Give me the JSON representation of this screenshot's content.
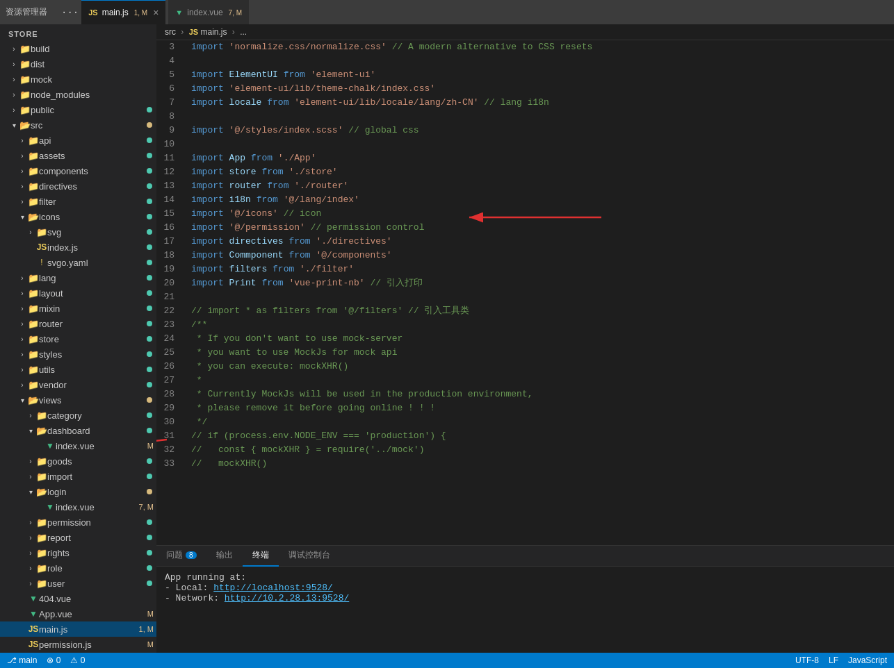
{
  "titleBar": {
    "title": "资源管理器",
    "dotsLabel": "···"
  },
  "tabs": [
    {
      "id": "main-js",
      "icon": "JS",
      "iconType": "js",
      "label": "main.js",
      "badge": "1, M",
      "active": true,
      "closable": true
    },
    {
      "id": "index-vue",
      "icon": "▼",
      "iconType": "vue",
      "label": "index.vue",
      "badge": "7, M",
      "active": false,
      "closable": false
    }
  ],
  "breadcrumb": {
    "parts": [
      "src",
      "JS main.js",
      "..."
    ]
  },
  "sidebar": {
    "header": "STORE",
    "items": [
      {
        "id": "build",
        "label": "build",
        "type": "folder",
        "indent": 1,
        "expanded": false,
        "badge": null
      },
      {
        "id": "dist",
        "label": "dist",
        "type": "folder",
        "indent": 1,
        "expanded": false,
        "badge": null
      },
      {
        "id": "mock",
        "label": "mock",
        "type": "folder",
        "indent": 1,
        "expanded": false,
        "badge": null
      },
      {
        "id": "node_modules",
        "label": "node_modules",
        "type": "folder",
        "indent": 1,
        "expanded": false,
        "badge": null
      },
      {
        "id": "public",
        "label": "public",
        "type": "folder",
        "indent": 1,
        "expanded": false,
        "badge": "green"
      },
      {
        "id": "src",
        "label": "src",
        "type": "folder",
        "indent": 1,
        "expanded": true,
        "badge": "orange"
      },
      {
        "id": "api",
        "label": "api",
        "type": "folder",
        "indent": 2,
        "expanded": false,
        "badge": "green"
      },
      {
        "id": "assets",
        "label": "assets",
        "type": "folder",
        "indent": 2,
        "expanded": false,
        "badge": "green"
      },
      {
        "id": "components",
        "label": "components",
        "type": "folder",
        "indent": 2,
        "expanded": false,
        "badge": "green"
      },
      {
        "id": "directives",
        "label": "directives",
        "type": "folder",
        "indent": 2,
        "expanded": false,
        "badge": "green"
      },
      {
        "id": "filter",
        "label": "filter",
        "type": "folder",
        "indent": 2,
        "expanded": false,
        "badge": "green"
      },
      {
        "id": "icons",
        "label": "icons",
        "type": "folder",
        "indent": 2,
        "expanded": true,
        "badge": "green"
      },
      {
        "id": "svg",
        "label": "svg",
        "type": "folder",
        "indent": 3,
        "expanded": false,
        "badge": "green"
      },
      {
        "id": "index-js",
        "label": "index.js",
        "type": "js",
        "indent": 3,
        "expanded": false,
        "badge": "green"
      },
      {
        "id": "svgo-yaml",
        "label": "svgo.yaml",
        "type": "yaml",
        "indent": 3,
        "expanded": false,
        "badge": "green"
      },
      {
        "id": "lang",
        "label": "lang",
        "type": "folder",
        "indent": 2,
        "expanded": false,
        "badge": "green"
      },
      {
        "id": "layout",
        "label": "layout",
        "type": "folder",
        "indent": 2,
        "expanded": false,
        "badge": "green"
      },
      {
        "id": "mixin",
        "label": "mixin",
        "type": "folder",
        "indent": 2,
        "expanded": false,
        "badge": "green"
      },
      {
        "id": "router",
        "label": "router",
        "type": "folder",
        "indent": 2,
        "expanded": false,
        "badge": "green"
      },
      {
        "id": "store",
        "label": "store",
        "type": "folder",
        "indent": 2,
        "expanded": false,
        "badge": "green"
      },
      {
        "id": "styles",
        "label": "styles",
        "type": "folder",
        "indent": 2,
        "expanded": false,
        "badge": "green"
      },
      {
        "id": "utils",
        "label": "utils",
        "type": "folder",
        "indent": 2,
        "expanded": false,
        "badge": "green"
      },
      {
        "id": "vendor",
        "label": "vendor",
        "type": "folder",
        "indent": 2,
        "expanded": false,
        "badge": "green"
      },
      {
        "id": "views",
        "label": "views",
        "type": "folder",
        "indent": 2,
        "expanded": true,
        "badge": "orange"
      },
      {
        "id": "category",
        "label": "category",
        "type": "folder",
        "indent": 3,
        "expanded": false,
        "badge": "green"
      },
      {
        "id": "dashboard",
        "label": "dashboard",
        "type": "folder",
        "indent": 3,
        "expanded": true,
        "badge": "green"
      },
      {
        "id": "dashboard-index",
        "label": "index.vue",
        "type": "vue",
        "indent": 4,
        "badge": "M"
      },
      {
        "id": "goods",
        "label": "goods",
        "type": "folder",
        "indent": 3,
        "expanded": false,
        "badge": "green"
      },
      {
        "id": "import",
        "label": "import",
        "type": "folder",
        "indent": 3,
        "expanded": false,
        "badge": "green"
      },
      {
        "id": "login",
        "label": "login",
        "type": "folder",
        "indent": 3,
        "expanded": true,
        "badge": "orange"
      },
      {
        "id": "login-index",
        "label": "index.vue",
        "type": "vue",
        "indent": 4,
        "badge": "7, M"
      },
      {
        "id": "permission",
        "label": "permission",
        "type": "folder",
        "indent": 3,
        "expanded": false,
        "badge": "green"
      },
      {
        "id": "report",
        "label": "report",
        "type": "folder",
        "indent": 3,
        "expanded": false,
        "badge": "green"
      },
      {
        "id": "rights",
        "label": "rights",
        "type": "folder",
        "indent": 3,
        "expanded": false,
        "badge": "green"
      },
      {
        "id": "role",
        "label": "role",
        "type": "folder",
        "indent": 3,
        "expanded": false,
        "badge": "green"
      },
      {
        "id": "user",
        "label": "user",
        "type": "folder",
        "indent": 3,
        "expanded": false,
        "badge": "green"
      },
      {
        "id": "404-vue",
        "label": "404.vue",
        "type": "vue",
        "indent": 2,
        "badge": null
      },
      {
        "id": "app-vue",
        "label": "App.vue",
        "type": "vue",
        "indent": 2,
        "badge": "M"
      },
      {
        "id": "main-js-side",
        "label": "main.js",
        "type": "js",
        "indent": 2,
        "badge": "1, M",
        "selected": true
      },
      {
        "id": "permission-js",
        "label": "permission.js",
        "type": "js",
        "indent": 2,
        "badge": "M"
      }
    ]
  },
  "codeLines": [
    {
      "num": 3,
      "indicator": false,
      "content": "import·'normalize.css/normalize.css'·//·A·modern·alternative·to·CSS·resets",
      "tokens": [
        {
          "t": "kw",
          "v": "import"
        },
        {
          "t": "str",
          "v": "'normalize.css/normalize.css'"
        },
        {
          "t": "cmt",
          "v": "//·A·modern·alternative·to·CSS·resets"
        }
      ]
    },
    {
      "num": 4,
      "indicator": false,
      "content": "",
      "tokens": []
    },
    {
      "num": 5,
      "indicator": false,
      "content": "import·ElementUI·from·'element-ui'",
      "tokens": [
        {
          "t": "kw",
          "v": "import"
        },
        {
          "t": "var",
          "v": "ElementUI"
        },
        {
          "t": "kw",
          "v": "from"
        },
        {
          "t": "str",
          "v": "'element-ui'"
        }
      ]
    },
    {
      "num": 6,
      "indicator": false,
      "content": "import·'element-ui/lib/theme-chalk/index.css'",
      "tokens": [
        {
          "t": "kw",
          "v": "import"
        },
        {
          "t": "str",
          "v": "'element-ui/lib/theme-chalk/index.css'"
        }
      ]
    },
    {
      "num": 7,
      "indicator": true,
      "content": "import·locale·from·'element-ui/lib/locale/lang/zh-CN'·//·lang·i18n",
      "tokens": [
        {
          "t": "kw",
          "v": "import"
        },
        {
          "t": "var",
          "v": "locale"
        },
        {
          "t": "kw",
          "v": "from"
        },
        {
          "t": "str",
          "v": "'element-ui/lib/locale/lang/zh-CN'"
        },
        {
          "t": "cmt",
          "v": "//·lang·i18n"
        }
      ]
    },
    {
      "num": 8,
      "indicator": false,
      "content": "",
      "tokens": []
    },
    {
      "num": 9,
      "indicator": false,
      "content": "import·'@/styles/index.scss'·//·global·css",
      "tokens": [
        {
          "t": "kw",
          "v": "import"
        },
        {
          "t": "str",
          "v": "'@/styles/index.scss'"
        },
        {
          "t": "cmt",
          "v": "//·global·css"
        }
      ]
    },
    {
      "num": 10,
      "indicator": false,
      "content": "",
      "tokens": []
    },
    {
      "num": 11,
      "indicator": false,
      "content": "import·App·from·'./App'",
      "tokens": [
        {
          "t": "kw",
          "v": "import"
        },
        {
          "t": "var",
          "v": "App"
        },
        {
          "t": "kw",
          "v": "from"
        },
        {
          "t": "str",
          "v": "'./App'"
        }
      ]
    },
    {
      "num": 12,
      "indicator": false,
      "content": "import·store·from·'./store'",
      "tokens": [
        {
          "t": "kw",
          "v": "import"
        },
        {
          "t": "var",
          "v": "store"
        },
        {
          "t": "kw",
          "v": "from"
        },
        {
          "t": "str",
          "v": "'./store'"
        }
      ]
    },
    {
      "num": 13,
      "indicator": false,
      "content": "import·router·from·'./router'",
      "tokens": [
        {
          "t": "kw",
          "v": "import"
        },
        {
          "t": "var",
          "v": "router"
        },
        {
          "t": "kw",
          "v": "from"
        },
        {
          "t": "str",
          "v": "'./router'"
        }
      ]
    },
    {
      "num": 14,
      "indicator": false,
      "content": "import·i18n·from·'@/lang/index'",
      "tokens": [
        {
          "t": "kw",
          "v": "import"
        },
        {
          "t": "var",
          "v": "i18n"
        },
        {
          "t": "kw",
          "v": "from"
        },
        {
          "t": "str",
          "v": "'@/lang/index'"
        }
      ]
    },
    {
      "num": 15,
      "indicator": true,
      "content": "import·'@/icons'·//·icon",
      "tokens": [
        {
          "t": "kw",
          "v": "import"
        },
        {
          "t": "str",
          "v": "'@/icons'"
        },
        {
          "t": "cmt",
          "v": "//·icon"
        }
      ]
    },
    {
      "num": 16,
      "indicator": false,
      "content": "import·'@/permission'·//·permission·control",
      "tokens": [
        {
          "t": "kw",
          "v": "import"
        },
        {
          "t": "str",
          "v": "'@/permission'"
        },
        {
          "t": "cmt",
          "v": "//·permission·control"
        }
      ]
    },
    {
      "num": 17,
      "indicator": false,
      "content": "import·directives·from·'./directives'",
      "tokens": [
        {
          "t": "kw",
          "v": "import"
        },
        {
          "t": "var",
          "v": "directives"
        },
        {
          "t": "kw",
          "v": "from"
        },
        {
          "t": "str",
          "v": "'./directives'"
        }
      ]
    },
    {
      "num": 18,
      "indicator": false,
      "content": "import·Commponent·from·'@/components'",
      "tokens": [
        {
          "t": "kw",
          "v": "import"
        },
        {
          "t": "var",
          "v": "Commponent"
        },
        {
          "t": "kw",
          "v": "from"
        },
        {
          "t": "str",
          "v": "'@/components'"
        }
      ]
    },
    {
      "num": 19,
      "indicator": false,
      "content": "import·filters·from·'./filter'",
      "tokens": [
        {
          "t": "kw",
          "v": "import"
        },
        {
          "t": "var",
          "v": "filters"
        },
        {
          "t": "kw",
          "v": "from"
        },
        {
          "t": "str",
          "v": "'./filter'"
        }
      ]
    },
    {
      "num": 20,
      "indicator": false,
      "content": "import·Print·from·'vue-print-nb'·//·引入打印",
      "tokens": [
        {
          "t": "kw",
          "v": "import"
        },
        {
          "t": "var",
          "v": "Print"
        },
        {
          "t": "kw",
          "v": "from"
        },
        {
          "t": "str",
          "v": "'vue-print-nb'"
        },
        {
          "t": "cmt",
          "v": "//·引入打印"
        }
      ]
    },
    {
      "num": 21,
      "indicator": false,
      "content": "",
      "tokens": []
    },
    {
      "num": 22,
      "indicator": false,
      "content": "//·import·*·as·filters·from·'@/filters'·//·引入工具类",
      "tokens": [
        {
          "t": "cmt",
          "v": "//·import·*·as·filters·from·'@/filters'·//·引入工具类"
        }
      ]
    },
    {
      "num": 23,
      "indicator": false,
      "content": "/**",
      "tokens": [
        {
          "t": "cmt",
          "v": "/**"
        }
      ]
    },
    {
      "num": 24,
      "indicator": false,
      "content": "·*·If·you·don't·want·to·use·mock-server",
      "tokens": [
        {
          "t": "cmt",
          "v": "·*·If·you·don't·want·to·use·mock-server"
        }
      ]
    },
    {
      "num": 25,
      "indicator": false,
      "content": "·*·you·want·to·use·MockJs·for·mock·api",
      "tokens": [
        {
          "t": "cmt",
          "v": "·*·you·want·to·use·MockJs·for·mock·api"
        }
      ]
    },
    {
      "num": 26,
      "indicator": false,
      "content": "·*·you·can·execute:·mockXHR()",
      "tokens": [
        {
          "t": "cmt",
          "v": "·*·you·can·execute:·mockXHR()"
        }
      ]
    },
    {
      "num": 27,
      "indicator": false,
      "content": "·*",
      "tokens": [
        {
          "t": "cmt",
          "v": "·*"
        }
      ]
    },
    {
      "num": 28,
      "indicator": false,
      "content": "·*·Currently·MockJs·will·be·used·in·the·production·environment,",
      "tokens": [
        {
          "t": "cmt",
          "v": "·*·Currently·MockJs·will·be·used·in·the·production·environment,"
        }
      ]
    },
    {
      "num": 29,
      "indicator": false,
      "content": "·*·please·remove·it·before·going·online·!·!·!",
      "tokens": [
        {
          "t": "cmt",
          "v": "·*·please·remove·it·before·going·online·!·!·!"
        }
      ]
    },
    {
      "num": 30,
      "indicator": false,
      "content": "·*/",
      "tokens": [
        {
          "t": "cmt",
          "v": "·*/"
        }
      ]
    },
    {
      "num": 31,
      "indicator": false,
      "content": "//·if·(process.env.NODE_ENV·===·'production')·{",
      "tokens": [
        {
          "t": "cmt",
          "v": "//·if·(process.env.NODE_ENV·===·'production')·{"
        }
      ]
    },
    {
      "num": 32,
      "indicator": false,
      "content": "//···const·{·mockXHR·}·=·require('../mock')",
      "tokens": [
        {
          "t": "cmt",
          "v": "//···const·{·mockXHR·}·=·require('../mock')"
        }
      ]
    },
    {
      "num": 33,
      "indicator": false,
      "content": "//···mockXHR()",
      "tokens": [
        {
          "t": "cmt",
          "v": "//···mockXHR()"
        }
      ]
    }
  ],
  "panelTabs": [
    {
      "id": "problems",
      "label": "问题",
      "badge": "8",
      "active": false
    },
    {
      "id": "output",
      "label": "输出",
      "badge": null,
      "active": false
    },
    {
      "id": "terminal",
      "label": "终端",
      "badge": null,
      "active": true
    },
    {
      "id": "debugconsole",
      "label": "调试控制台",
      "badge": null,
      "active": false
    }
  ],
  "terminal": {
    "line1": "App running at:",
    "line2label": "- Local:   ",
    "line2link": "http://localhost:9528/",
    "line3label": "- Network: ",
    "line3link": "http://10.2.28.13:9528/"
  },
  "statusBar": {
    "branch": "⎇ main",
    "errors": "⊗ 0",
    "warnings": "⚠ 0",
    "encoding": "UTF-8",
    "lineEnding": "LF",
    "language": "JavaScript"
  }
}
